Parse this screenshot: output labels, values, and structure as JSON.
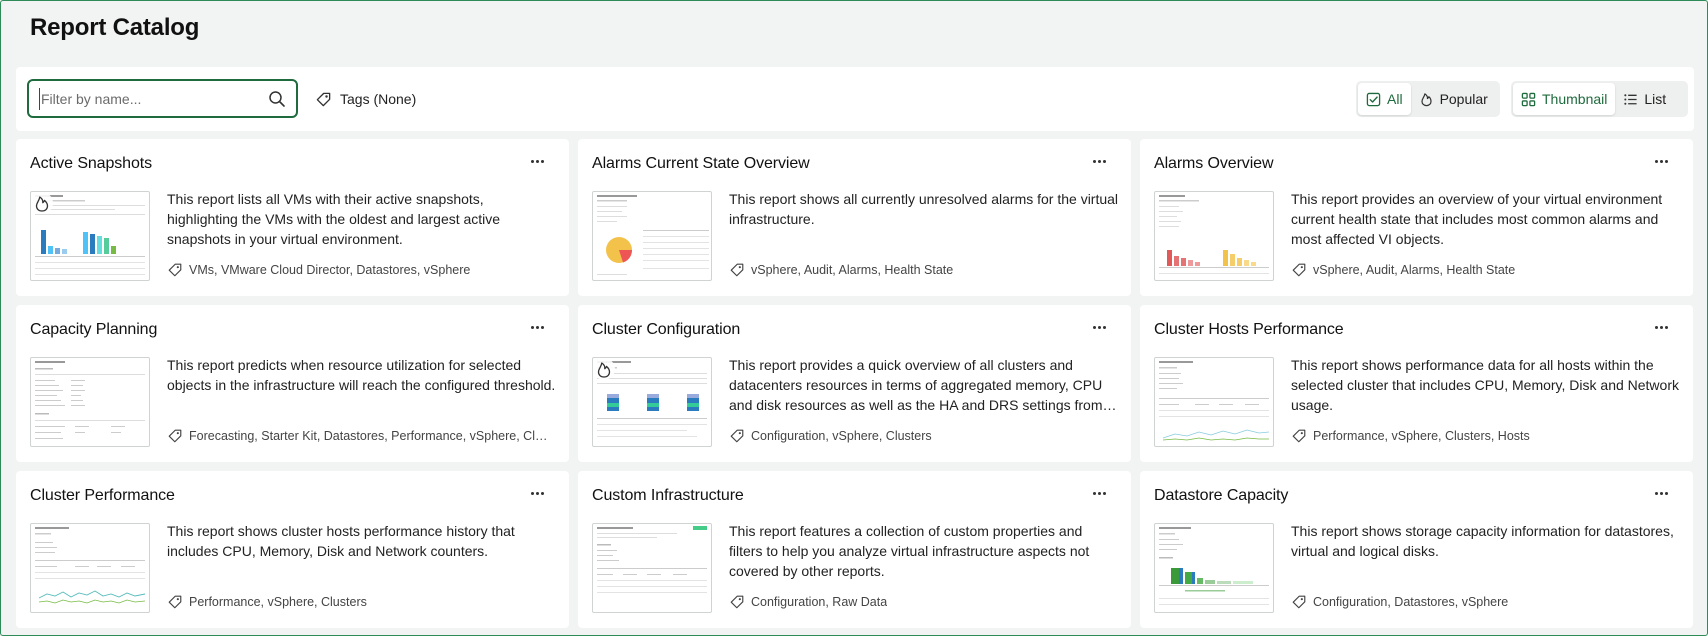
{
  "page": {
    "title": "Report Catalog"
  },
  "toolbar": {
    "search_placeholder": "Filter by name...",
    "tags_label": "Tags (None)",
    "filter": {
      "all_label": "All",
      "popular_label": "Popular",
      "selected": "All"
    },
    "view": {
      "thumbnail_label": "Thumbnail",
      "list_label": "List",
      "selected": "Thumbnail"
    }
  },
  "colors": {
    "accent": "#1f6b3d",
    "frame": "#2e8b57",
    "background": "#f2f3f3",
    "card": "#ffffff"
  },
  "cards": [
    {
      "title": "Active Snapshots",
      "description": "This report lists all VMs with their active snapshots, highlighting the VMs with the oldest and largest active snapshots in your virtual environment.",
      "tags": "VMs, VMware Cloud Director, Datastores, vSphere",
      "popular": true,
      "thumb": "bars-blue"
    },
    {
      "title": "Alarms Current State Overview",
      "description": "This report shows all currently unresolved alarms for the virtual infrastructure.",
      "tags": "vSphere, Audit, Alarms, Health State",
      "popular": false,
      "thumb": "pie"
    },
    {
      "title": "Alarms Overview",
      "description": "This report provides an overview of your virtual environment current health state that includes most common alarms and most affected VI objects.",
      "tags": "vSphere, Audit, Alarms, Health State",
      "popular": false,
      "thumb": "bars-red"
    },
    {
      "title": "Capacity Planning",
      "description": "This report predicts when resource utilization for selected objects in the infrastructure will reach the configured threshold.",
      "tags": "Forecasting, Starter Kit, Datastores, Performance, vSphere, Clusters",
      "popular": false,
      "thumb": "text"
    },
    {
      "title": "Cluster Configuration",
      "description": "This report provides a quick overview of all clusters and datacenters resources in terms of aggregated memory, CPU and disk resources as well as the HA and DRS settings from the clusters.",
      "tags": "Configuration, vSphere, Clusters",
      "popular": true,
      "thumb": "stacked"
    },
    {
      "title": "Cluster Hosts Performance",
      "description": "This report shows performance data for all hosts within the selected cluster that includes CPU, Memory, Disk and Network usage.",
      "tags": "Performance, vSphere, Clusters, Hosts",
      "popular": false,
      "thumb": "table-line"
    },
    {
      "title": "Cluster Performance",
      "description": "This report shows cluster hosts performance history that includes CPU, Memory, Disk and Network counters.",
      "tags": "Performance, vSphere, Clusters",
      "popular": false,
      "thumb": "line"
    },
    {
      "title": "Custom Infrastructure",
      "description": "This report features a collection of custom properties and filters to help you analyze virtual infrastructure aspects not covered by other reports.",
      "tags": "Configuration, Raw Data",
      "popular": false,
      "thumb": "table"
    },
    {
      "title": "Datastore Capacity",
      "description": "This report shows storage capacity information for datastores, virtual and logical disks.",
      "tags": "Configuration, Datastores, vSphere",
      "popular": false,
      "thumb": "bars-green"
    }
  ]
}
